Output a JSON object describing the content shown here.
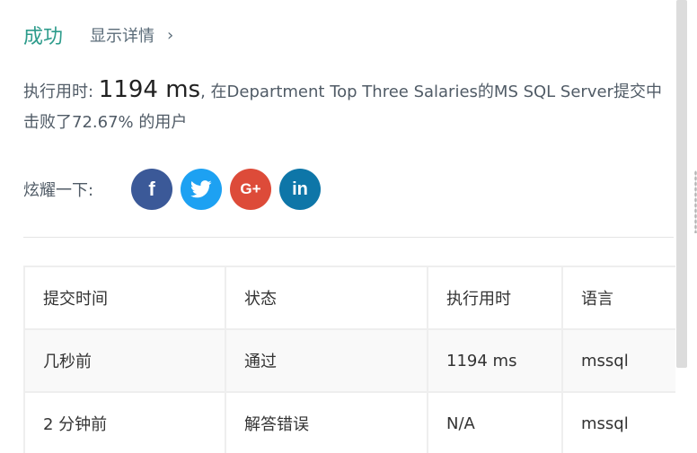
{
  "header": {
    "status": "成功",
    "details_link": "显示详情",
    "details_chevron": "›"
  },
  "runtime": {
    "label": "执行用时: ",
    "value": "1194 ms",
    "text_after": ", 在Department Top Three Salaries的MS SQL Server提交中",
    "beat_text": "击败了72.67% 的用户"
  },
  "share": {
    "label": "炫耀一下:",
    "buttons": [
      {
        "icon": "facebook-icon",
        "glyph": "f",
        "color": "#3b5998"
      },
      {
        "icon": "twitter-icon",
        "glyph": "🐦",
        "color": "#1da1f2"
      },
      {
        "icon": "google-plus-icon",
        "glyph": "G+",
        "color": "#dd4b39"
      },
      {
        "icon": "linkedin-icon",
        "glyph": "in",
        "color": "#0e76a8"
      }
    ]
  },
  "table": {
    "headers": [
      "提交时间",
      "状态",
      "执行用时",
      "语言"
    ],
    "rows": [
      {
        "time": "几秒前",
        "status": "通过",
        "runtime": "1194 ms",
        "language": "mssql"
      },
      {
        "time": "2 分钟前",
        "status": "解答错误",
        "runtime": "N/A",
        "language": "mssql"
      }
    ]
  },
  "colors": {
    "success": "#2e9c8c",
    "error": "#d9534f"
  }
}
